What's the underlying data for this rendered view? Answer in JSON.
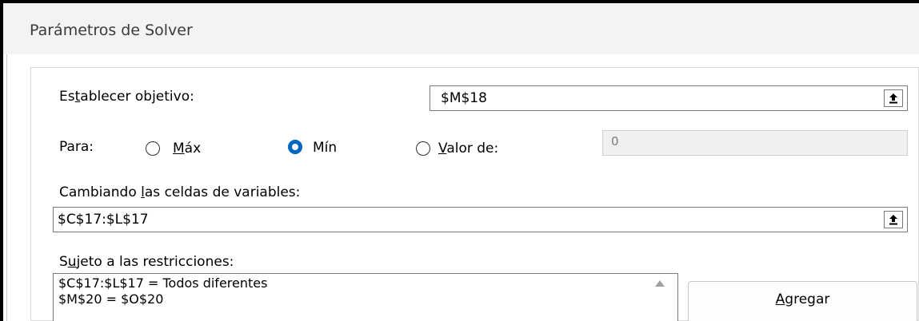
{
  "window": {
    "title": "Parámetros de Solver"
  },
  "objective": {
    "label_pre": "Es",
    "label_ul": "t",
    "label_post": "ablecer objetivo:",
    "value": "$M$18",
    "ref_icon": "collapse-dialog-icon"
  },
  "para": {
    "label": "Para:",
    "options": [
      {
        "pre": "",
        "ul": "M",
        "post": "áx",
        "checked": false
      },
      {
        "pre": "",
        "ul": "",
        "post": "Mín",
        "checked": true
      },
      {
        "pre": "",
        "ul": "V",
        "post": "alor de:",
        "checked": false
      }
    ],
    "value_of": "0"
  },
  "variables": {
    "label_pre": "Cambiando ",
    "label_ul": "l",
    "label_post": "as celdas de variables:",
    "value": "$C$17:$L$17",
    "ref_icon": "collapse-dialog-icon"
  },
  "constraints": {
    "label_pre": "S",
    "label_ul": "u",
    "label_post": "jeto a las restricciones:",
    "items": [
      "$C$17:$L$17 = Todos diferentes",
      "$M$20 = $O$20"
    ]
  },
  "add_button": {
    "pre": "",
    "ul": "A",
    "post": "gregar"
  },
  "colors": {
    "accent": "#0067c0",
    "titlebar": "#f3f3f3"
  }
}
